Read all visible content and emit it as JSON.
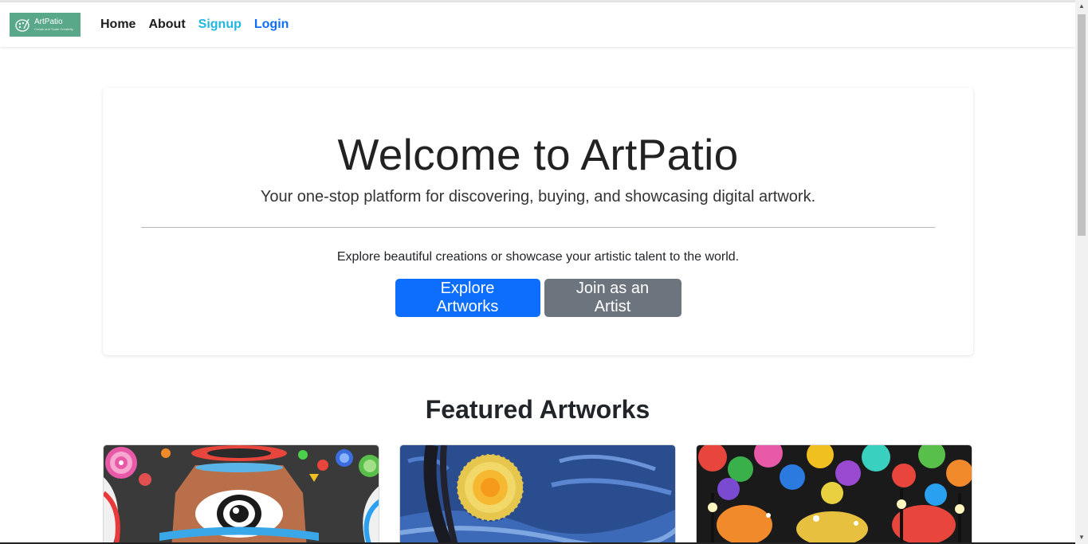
{
  "brand": {
    "name": "ArtPatio",
    "tagline": "Create and Trade Creativity"
  },
  "nav": {
    "home": "Home",
    "about": "About",
    "signup": "Signup",
    "login": "Login"
  },
  "hero": {
    "title": "Welcome to ArtPatio",
    "subtitle": "Your one-stop platform for discovering, buying, and showcasing digital artwork.",
    "text": "Explore beautiful creations or showcase your artistic talent to the world.",
    "primary_button": "Explore Artworks",
    "secondary_button": "Join as an Artist"
  },
  "featured": {
    "title": "Featured Artworks"
  },
  "colors": {
    "primary": "#0d6efd",
    "secondary": "#6c757d",
    "logo_bg": "#5aa88a",
    "signup": "#1fb6e0"
  }
}
